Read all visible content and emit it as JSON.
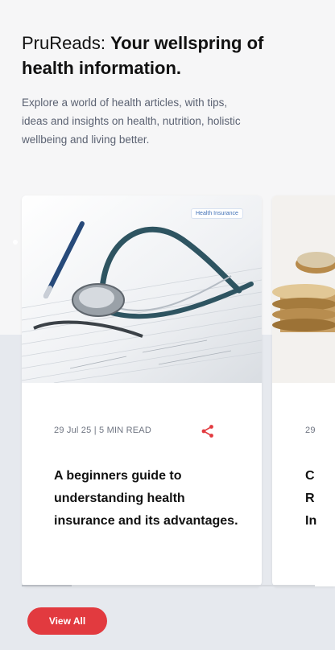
{
  "header": {
    "title_brand": "PruReads:",
    "title_rest": "Your wellspring of health information.",
    "description": "Explore a world of health articles, with tips, ideas and insights on health, nutrition, holistic wellbeing and living better."
  },
  "cards": [
    {
      "tag": "Health Insurance",
      "meta": "29 Jul 25 | 5 MIN READ",
      "title": "A beginners guide to understanding health insurance and its advantages.",
      "image_icon": "stethoscope-image",
      "share_icon": "share-icon"
    },
    {
      "meta": "29",
      "title": "C\nR\nIn",
      "image_icon": "coins-image"
    }
  ],
  "carousel": {
    "progress_fraction": 0.17
  },
  "actions": {
    "view_all_label": "View All"
  },
  "colors": {
    "accent": "#e23a3f",
    "tag_text": "#3f6fb5"
  }
}
